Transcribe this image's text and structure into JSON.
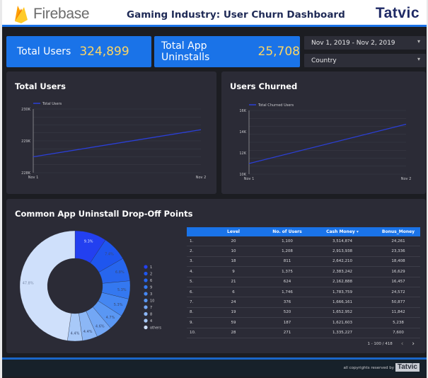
{
  "header": {
    "brand_left": "Firebase",
    "title": "Gaming Industry: User Churn Dashboard",
    "brand_right": "Tatvic"
  },
  "kpis": [
    {
      "label": "Total Users",
      "value": "324,899"
    },
    {
      "label": "Total App Uninstalls",
      "value": "25,708"
    }
  ],
  "controls": {
    "date_range": "Nov 1, 2019 - Nov 2, 2019",
    "country_filter": "Country"
  },
  "colors": {
    "accent": "#1a73e8",
    "kpi_value": "#fdd663",
    "line": "#2b3fd6",
    "card_bg": "#2b2b36"
  },
  "chart_data": [
    {
      "type": "line",
      "title": "Total Users",
      "legend": [
        "Total Users"
      ],
      "legend_position": "top-left",
      "x": [
        "Nov 1",
        "Nov 2"
      ],
      "series": [
        {
          "name": "Total Users",
          "values": [
            228500,
            229350
          ]
        }
      ],
      "yticks": [
        "228K",
        "229K",
        "230K"
      ],
      "ylim": [
        228000,
        230000
      ],
      "grid": true
    },
    {
      "type": "line",
      "title": "Users Churned",
      "legend": [
        "Total Churned Users"
      ],
      "legend_position": "top-left",
      "x": [
        "Nov 1",
        "Nov 2"
      ],
      "series": [
        {
          "name": "Total Churned Users",
          "values": [
            11000,
            14700
          ]
        }
      ],
      "yticks": [
        "10K",
        "12K",
        "14K",
        "16K"
      ],
      "ylim": [
        10000,
        16000
      ],
      "grid": true
    },
    {
      "type": "pie",
      "title": "Common App Uninstall Drop-Off Points",
      "donut": true,
      "legend_position": "right",
      "slices": [
        {
          "label": "1",
          "value": 9.3,
          "color": "#2340f0"
        },
        {
          "label": "2",
          "value": 7.4,
          "color": "#1f56ee"
        },
        {
          "label": "6",
          "value": 6.8,
          "color": "#2766ee"
        },
        {
          "label": "9",
          "value": 5.3,
          "color": "#3478f0"
        },
        {
          "label": "3",
          "value": 5.3,
          "color": "#4587f2"
        },
        {
          "label": "10",
          "value": 4.7,
          "color": "#5a97f3"
        },
        {
          "label": "7",
          "value": 4.6,
          "color": "#73a7f5"
        },
        {
          "label": "8",
          "value": 4.4,
          "color": "#8cb7f6"
        },
        {
          "label": "4",
          "value": 4.4,
          "color": "#a8c9f8"
        },
        {
          "label": "others",
          "value": 47.8,
          "color": "#cfe0fb"
        }
      ]
    },
    {
      "type": "table",
      "columns": [
        "",
        "Level",
        "No. of Users",
        "Cash Money",
        "Bonus_Money"
      ],
      "sort_indicator": "▾",
      "rows": [
        [
          "1.",
          "20",
          "1,100",
          "3,514,874",
          "24,261"
        ],
        [
          "2.",
          "10",
          "1,208",
          "2,913,938",
          "23,336"
        ],
        [
          "3.",
          "18",
          "811",
          "2,642,210",
          "18,408"
        ],
        [
          "4.",
          "9",
          "1,375",
          "2,383,242",
          "16,629"
        ],
        [
          "5.",
          "21",
          "624",
          "2,162,888",
          "16,457"
        ],
        [
          "6.",
          "6",
          "1,746",
          "1,783,759",
          "24,572"
        ],
        [
          "7.",
          "24",
          "376",
          "1,666,161",
          "50,877"
        ],
        [
          "8.",
          "19",
          "520",
          "1,652,952",
          "11,842"
        ],
        [
          "9.",
          "59",
          "187",
          "1,621,603",
          "5,238"
        ],
        [
          "10.",
          "28",
          "271",
          "1,335,227",
          "7,600"
        ]
      ],
      "pagination": "1 - 100 / 418"
    }
  ],
  "footer": {
    "copyright": "all copyrights reserved by",
    "brand": "Tatvic"
  }
}
